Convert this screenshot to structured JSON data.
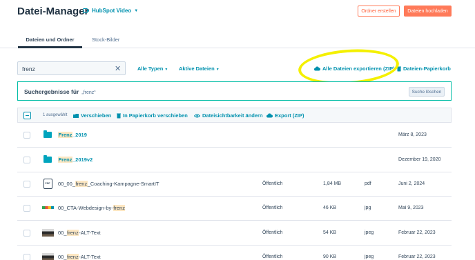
{
  "header": {
    "title": "Datei-Manager",
    "account": "HubSpot Video",
    "btn_create_folder": "Ordner erstellen",
    "btn_upload": "Dateien hochladen"
  },
  "tabs": [
    {
      "label": "Dateien und Ordner",
      "active": true
    },
    {
      "label": "Stock-Bilder",
      "active": false
    }
  ],
  "search": {
    "value": "frenz"
  },
  "filters": {
    "types": "Alle Typen",
    "active": "Aktive Dateien"
  },
  "actions_top": {
    "export_all": "Alle Dateien exportieren (ZIP)",
    "trash": "Dateien-Papierkorb"
  },
  "results": {
    "label": "Suchergebnisse für",
    "query": "„frenz“",
    "clear": "Suche löschen"
  },
  "bulk": {
    "selected": "1 ausgewählt",
    "move": "Verschieben",
    "to_trash": "In Papierkorb verschieben",
    "visibility": "Dateisichtbarkeit ändern",
    "export": "Export (ZIP)"
  },
  "files": [
    {
      "pre": "",
      "hit": "Frenz",
      "post": "_2019",
      "kind": "folder",
      "visibility": "",
      "size": "",
      "type": "",
      "date": "März 8, 2023"
    },
    {
      "pre": "",
      "hit": "Frenz",
      "post": "_2019v2",
      "kind": "folder",
      "visibility": "",
      "size": "",
      "type": "",
      "date": "Dezember 19, 2020"
    },
    {
      "pre": "00_00_",
      "hit": "frenz",
      "post": "_Coaching-Kampagne-SmartIT",
      "kind": "pdf",
      "visibility": "Öffentlich",
      "size": "1,84 MB",
      "type": "pdf",
      "date": "Juni 2, 2024"
    },
    {
      "pre": "00_CTA-Webdesign-by-",
      "hit": "frenz",
      "post": "",
      "kind": "logo",
      "visibility": "Öffentlich",
      "size": "46 KB",
      "type": "jpg",
      "date": "Mai 9, 2023"
    },
    {
      "pre": "00_",
      "hit": "frenz",
      "post": "-ALT-Text",
      "kind": "photo",
      "visibility": "Öffentlich",
      "size": "54 KB",
      "type": "jpeg",
      "date": "Februar 22, 2023"
    },
    {
      "pre": "00_",
      "hit": "frenz",
      "post": "-ALT-Text",
      "kind": "photo",
      "visibility": "Öffentlich",
      "size": "90 KB",
      "type": "jpeg",
      "date": "Februar 22, 2023"
    }
  ],
  "colors": {
    "accent": "#0091ae",
    "brand": "#ff7a59",
    "highlight": "#f4f000"
  }
}
